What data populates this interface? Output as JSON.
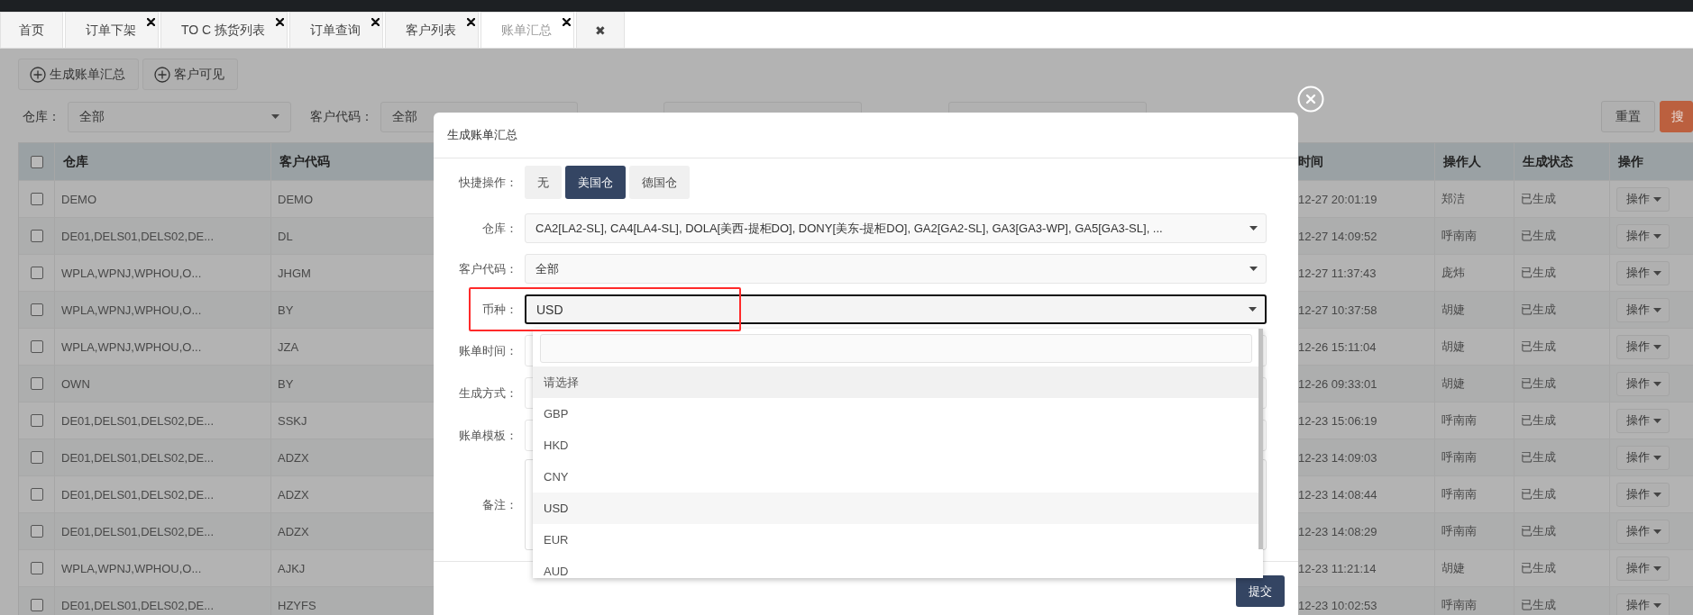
{
  "tabs": [
    {
      "label": "首页",
      "selected": false,
      "closable": false
    },
    {
      "label": "订单下架",
      "selected": false,
      "closable": true
    },
    {
      "label": "TO C 拣货列表",
      "selected": false,
      "closable": true
    },
    {
      "label": "订单查询",
      "selected": false,
      "closable": true
    },
    {
      "label": "客户列表",
      "selected": false,
      "closable": true
    },
    {
      "label": "账单汇总",
      "selected": true,
      "closable": true
    },
    {
      "label": "✖",
      "selected": false,
      "closable": false
    }
  ],
  "toolbar": {
    "buttons": [
      {
        "label": "生成账单汇总"
      },
      {
        "label": "客户可见"
      }
    ]
  },
  "filters": [
    {
      "label": "仓库：",
      "value": "全部"
    },
    {
      "label": "客户代码：",
      "value": "全部"
    }
  ],
  "filter_buttons": [
    {
      "label": "重置",
      "kind": "default"
    },
    {
      "label": "搜",
      "kind": "primary"
    }
  ],
  "table": {
    "header_checked": false,
    "columns": [
      "仓库",
      "客户代码",
      "时间",
      "操作人",
      "生成状态",
      "操作"
    ],
    "rows": [
      {
        "checked": false,
        "warehouse": "DEMO",
        "customer": "DEMO",
        "time": "12-27 20:01:19",
        "operator": "郑洁",
        "status": "已生成",
        "action": "操作"
      },
      {
        "checked": false,
        "warehouse": "DE01,DELS01,DELS02,DE...",
        "customer": "DL",
        "time": "12-27 14:09:52",
        "operator": "呼南南",
        "status": "已生成",
        "action": "操作"
      },
      {
        "checked": false,
        "warehouse": "WPLA,WPNJ,WPHOU,O...",
        "customer": "JHGM",
        "time": "12-27 11:37:43",
        "operator": "庞炜",
        "status": "已生成",
        "action": "操作"
      },
      {
        "checked": false,
        "warehouse": "WPLA,WPNJ,WPHOU,O...",
        "customer": "BY",
        "time": "12-27 10:37:58",
        "operator": "胡婕",
        "status": "已生成",
        "action": "操作"
      },
      {
        "checked": false,
        "warehouse": "WPLA,WPNJ,WPHOU,O...",
        "customer": "JZA",
        "time": "12-26 15:11:04",
        "operator": "胡婕",
        "status": "已生成",
        "action": "操作"
      },
      {
        "checked": false,
        "warehouse": "OWN",
        "customer": "BY",
        "time": "12-26 09:33:01",
        "operator": "胡婕",
        "status": "已生成",
        "action": "操作"
      },
      {
        "checked": false,
        "warehouse": "DE01,DELS01,DELS02,DE...",
        "customer": "SSKJ",
        "time": "12-23 15:06:19",
        "operator": "呼南南",
        "status": "已生成",
        "action": "操作"
      },
      {
        "checked": false,
        "warehouse": "DE01,DELS01,DELS02,DE...",
        "customer": "ADZX",
        "time": "12-23 14:09:03",
        "operator": "呼南南",
        "status": "已生成",
        "action": "操作"
      },
      {
        "checked": false,
        "warehouse": "DE01,DELS01,DELS02,DE...",
        "customer": "ADZX",
        "time": "12-23 14:08:44",
        "operator": "呼南南",
        "status": "已生成",
        "action": "操作"
      },
      {
        "checked": false,
        "warehouse": "DE01,DELS01,DELS02,DE...",
        "customer": "ADZX",
        "time": "12-23 14:08:29",
        "operator": "呼南南",
        "status": "已生成",
        "action": "操作"
      },
      {
        "checked": false,
        "warehouse": "WPLA,WPNJ,WPHOU,O...",
        "customer": "AJKJ",
        "time": "12-23 11:21:14",
        "operator": "胡婕",
        "status": "已生成",
        "action": "操作"
      },
      {
        "checked": false,
        "warehouse": "DE01,DELS01,DELS02,DE...",
        "customer": "HZYFS",
        "time": "12-23 10:02:53",
        "operator": "呼南南",
        "status": "已生成",
        "action": "操作"
      }
    ]
  },
  "dialog": {
    "title": "生成账单汇总",
    "quick": {
      "label": "快捷操作：",
      "options": [
        {
          "label": "无",
          "selected": false
        },
        {
          "label": "美国仓",
          "selected": true
        },
        {
          "label": "德国仓",
          "selected": false
        }
      ]
    },
    "fields": [
      {
        "label": "仓库：",
        "kind": "select",
        "value": "CA2[LA2-SL], CA4[LA4-SL], DOLA[美西-提柜DO], DONY[美东-提柜DO], GA2[GA2-SL], GA3[GA3-WP], GA5[GA3-SL], ...",
        "focused": false
      },
      {
        "label": "客户代码：",
        "kind": "select",
        "value": "全部",
        "focused": false
      },
      {
        "label": "币种：",
        "kind": "select",
        "value": "USD",
        "focused": true
      },
      {
        "label": "账单时间：",
        "kind": "input"
      },
      {
        "label": "生成方式：",
        "kind": "input"
      },
      {
        "label": "账单模板：",
        "kind": "input"
      },
      {
        "label": "备注：",
        "kind": "textarea"
      }
    ],
    "dropdown": {
      "options": [
        {
          "label": "请选择",
          "selected": false,
          "hovered": true
        },
        {
          "label": "GBP",
          "selected": false,
          "hovered": false
        },
        {
          "label": "HKD",
          "selected": false,
          "hovered": false
        },
        {
          "label": "CNY",
          "selected": false,
          "hovered": false
        },
        {
          "label": "USD",
          "selected": true,
          "hovered": false
        },
        {
          "label": "EUR",
          "selected": false,
          "hovered": false
        },
        {
          "label": "AUD",
          "selected": false,
          "hovered": false
        }
      ]
    },
    "submit": "提交"
  }
}
